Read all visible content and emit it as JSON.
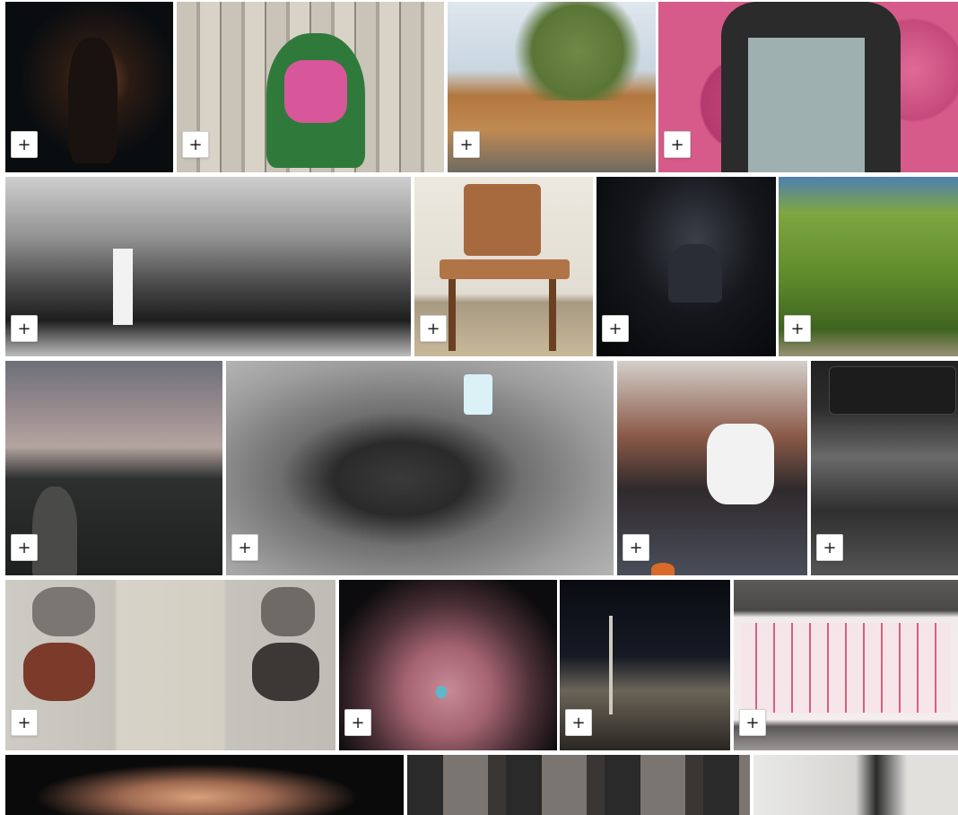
{
  "gallery": {
    "add_button_label": "+",
    "tiles": [
      {
        "id": "t1"
      },
      {
        "id": "t2"
      },
      {
        "id": "t3"
      },
      {
        "id": "t4"
      },
      {
        "id": "t5"
      },
      {
        "id": "t6"
      },
      {
        "id": "t7"
      },
      {
        "id": "t8"
      },
      {
        "id": "t9"
      },
      {
        "id": "t10"
      },
      {
        "id": "t11"
      },
      {
        "id": "t12"
      },
      {
        "id": "t13"
      },
      {
        "id": "t14"
      },
      {
        "id": "t15"
      },
      {
        "id": "t16"
      },
      {
        "id": "t17"
      },
      {
        "id": "t18"
      },
      {
        "id": "t19"
      }
    ]
  },
  "colors": {
    "button_bg": "#ffffff",
    "button_border": "#d0d0d0",
    "page_bg": "#ffffff"
  }
}
